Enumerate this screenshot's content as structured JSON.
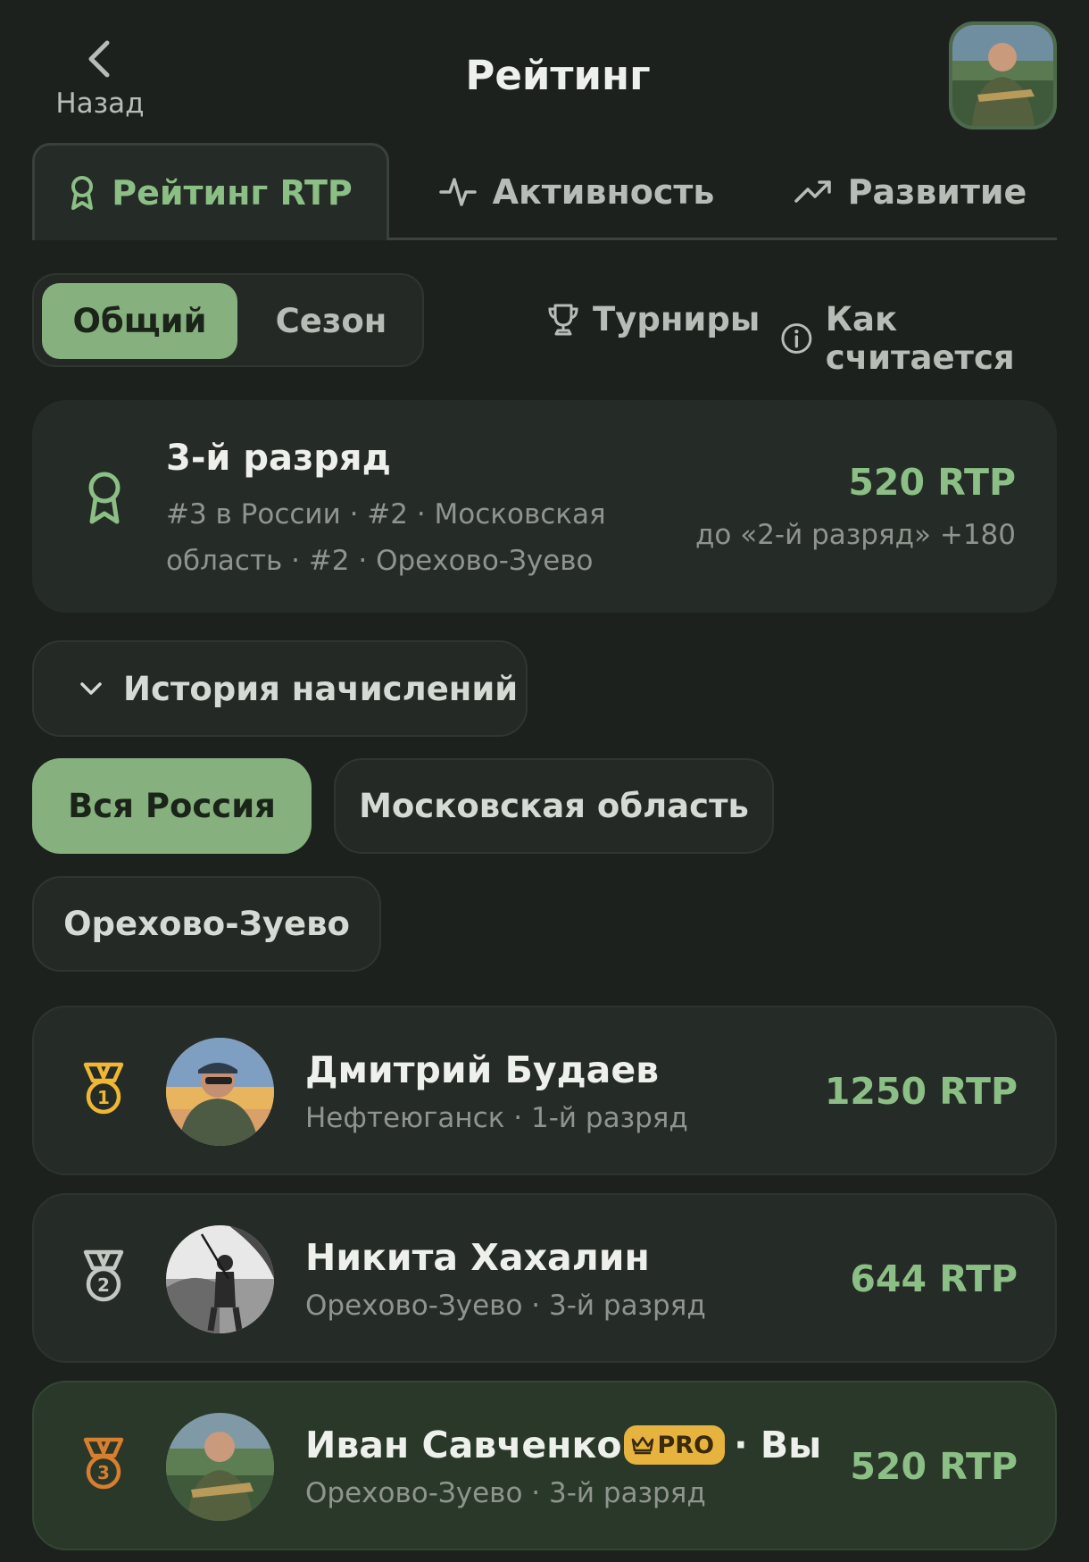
{
  "header": {
    "back_label": "Назад",
    "title": "Рейтинг"
  },
  "tabs": [
    {
      "label": "Рейтинг RTP",
      "icon": "award-icon",
      "active": true
    },
    {
      "label": "Активность",
      "icon": "activity-icon",
      "active": false
    },
    {
      "label": "Развитие",
      "icon": "trending-up-icon",
      "active": false
    }
  ],
  "filters": {
    "segments": [
      "Общий",
      "Сезон"
    ],
    "selected": "Общий",
    "tournaments_label": "Турниры",
    "how_label": "Как считается"
  },
  "summary": {
    "rank_title": "3-й разряд",
    "places_line1": "#3 в России · #2 · Московская",
    "places_line2": "область · #2 · Орехово-Зуево",
    "rtp": "520 RTP",
    "next_rank": "до «2-й разряд» +180"
  },
  "history": {
    "label": "История начислений"
  },
  "regions": {
    "items": [
      "Вся Россия",
      "Московская область",
      "Орехово-Зуево"
    ],
    "selected": "Вся Россия"
  },
  "leaderboard": [
    {
      "name": "Дмитрий Будаев",
      "meta": "Нефтеюганск · 1-й разряд",
      "score": "1250 RTP",
      "medal": "gold"
    },
    {
      "name": "Никита Хахалин",
      "meta": "Орехово-Зуево · 3-й разряд",
      "score": "644 RTP",
      "medal": "silver"
    },
    {
      "name": "Иван Савченко",
      "badge": "PRO",
      "you_label": "· Вы",
      "meta": "Орехово-Зуево · 3-й разряд",
      "score": "520 RTP",
      "medal": "bronze"
    }
  ],
  "colors": {
    "background": "#1d211e",
    "card": "#252b26",
    "accent_green": "#86b07e",
    "gold": "#f0b832",
    "silver": "#c4c8c3",
    "bronze": "#d77e2f",
    "pro_badge": "#e6b43e"
  }
}
